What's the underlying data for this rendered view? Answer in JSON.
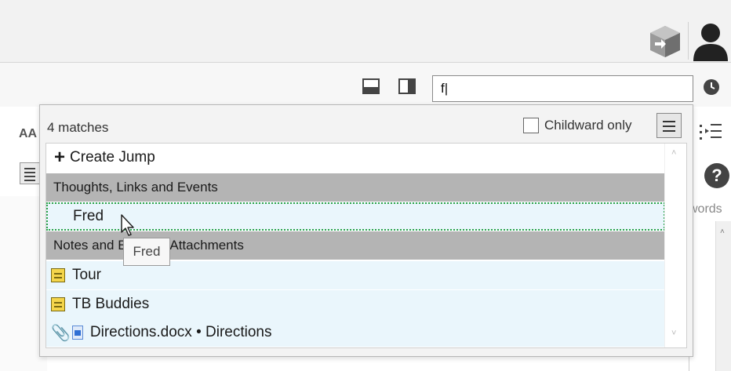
{
  "search": {
    "value": "f|"
  },
  "background": {
    "font_size_label": "AA",
    "words_label": "words",
    "help_glyph": "?"
  },
  "popup": {
    "match_count": "4 matches",
    "childward_label": "Childward only",
    "childward_checked": false,
    "create_jump": {
      "icon": "+",
      "label": "Create Jump"
    },
    "sections": [
      {
        "title": "Thoughts, Links and Events"
      },
      {
        "title": "Notes and External Attachments"
      }
    ],
    "thought_items": [
      {
        "label": "Fred",
        "selected": true
      }
    ],
    "note_items": [
      {
        "label": "Tour",
        "icon": "note-icon"
      },
      {
        "label": "TB Buddies",
        "icon": "note-icon"
      },
      {
        "label": "Directions.docx • Directions",
        "icon": "attachment-doc-icon"
      }
    ]
  },
  "tooltip": {
    "text": "Fred"
  },
  "colors": {
    "section_bg": "#b4b4b4",
    "item_bg": "#eaf6fc",
    "focus_border": "#2aa34a",
    "note_yellow": "#f4d54b"
  }
}
